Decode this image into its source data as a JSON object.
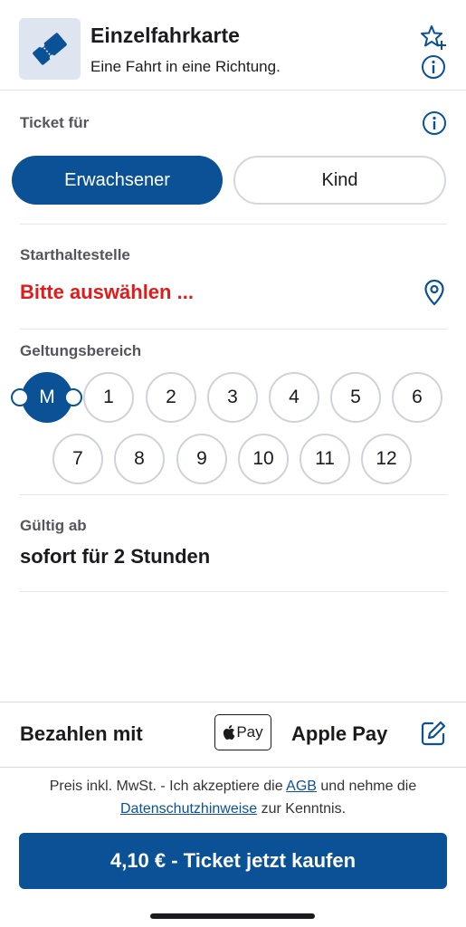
{
  "header": {
    "title": "Einzelfahrkarte",
    "subtitle": "Eine Fahrt in eine Richtung.",
    "icons": [
      "ticket-icon",
      "star-plus-icon",
      "info-icon"
    ]
  },
  "ticket_for": {
    "label": "Ticket für",
    "options": [
      "Erwachsener",
      "Kind"
    ],
    "selected": "Erwachsener"
  },
  "start_stop": {
    "label": "Starthaltestelle",
    "value": "Bitte auswählen ..."
  },
  "zones": {
    "label": "Geltungsbereich",
    "row1": [
      "M",
      "1",
      "2",
      "3",
      "4",
      "5",
      "6"
    ],
    "row2": [
      "7",
      "8",
      "9",
      "10",
      "11",
      "12"
    ],
    "selected": "M"
  },
  "valid_from": {
    "label": "Gültig ab",
    "value": "sofort für 2 Stunden"
  },
  "payment": {
    "label": "Bezahlen mit",
    "badge": "Pay",
    "method": "Apple Pay"
  },
  "legal": {
    "part1": "Preis inkl. MwSt. - Ich akzeptiere die ",
    "agb": "AGB",
    "part2": " und nehme die ",
    "privacy": "Datenschutzhinweise",
    "part3": " zur Kenntnis."
  },
  "buy_button": "4,10 € - Ticket jetzt kaufen",
  "colors": {
    "primary": "#0b5196",
    "error": "#e11a1a"
  }
}
